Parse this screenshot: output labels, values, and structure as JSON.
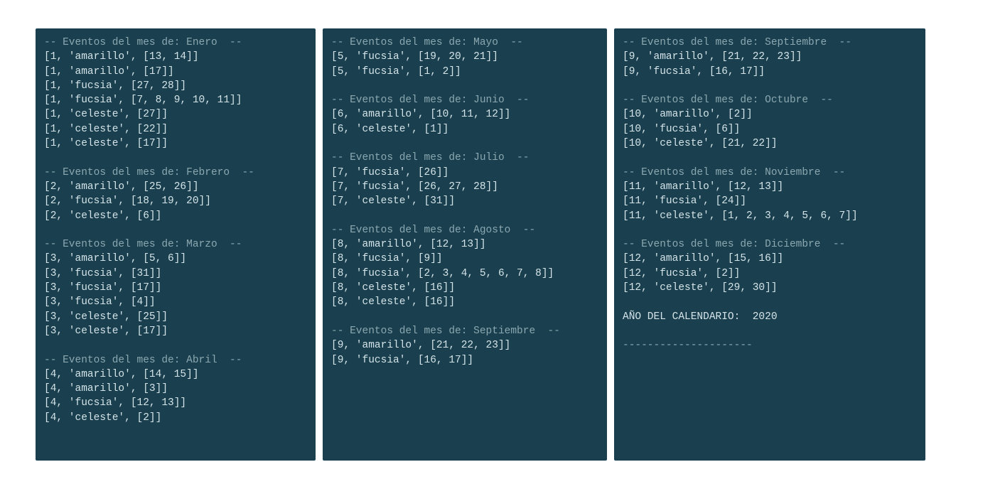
{
  "header_prefix": "-- Eventos del mes de: ",
  "header_suffix": "  --",
  "footer_label": "AÑO DEL CALENDARIO:  ",
  "footer_year": "2020",
  "footer_divider": "---------------------",
  "panels": [
    {
      "months": [
        {
          "name": "Enero",
          "events": [
            {
              "month": 1,
              "color": "amarillo",
              "days": [
                13,
                14
              ]
            },
            {
              "month": 1,
              "color": "amarillo",
              "days": [
                17
              ]
            },
            {
              "month": 1,
              "color": "fucsia",
              "days": [
                27,
                28
              ]
            },
            {
              "month": 1,
              "color": "fucsia",
              "days": [
                7,
                8,
                9,
                10,
                11
              ]
            },
            {
              "month": 1,
              "color": "celeste",
              "days": [
                27
              ]
            },
            {
              "month": 1,
              "color": "celeste",
              "days": [
                22
              ]
            },
            {
              "month": 1,
              "color": "celeste",
              "days": [
                17
              ]
            }
          ]
        },
        {
          "name": "Febrero",
          "events": [
            {
              "month": 2,
              "color": "amarillo",
              "days": [
                25,
                26
              ]
            },
            {
              "month": 2,
              "color": "fucsia",
              "days": [
                18,
                19,
                20
              ]
            },
            {
              "month": 2,
              "color": "celeste",
              "days": [
                6
              ]
            }
          ]
        },
        {
          "name": "Marzo",
          "events": [
            {
              "month": 3,
              "color": "amarillo",
              "days": [
                5,
                6
              ]
            },
            {
              "month": 3,
              "color": "fucsia",
              "days": [
                31
              ]
            },
            {
              "month": 3,
              "color": "fucsia",
              "days": [
                17
              ]
            },
            {
              "month": 3,
              "color": "fucsia",
              "days": [
                4
              ]
            },
            {
              "month": 3,
              "color": "celeste",
              "days": [
                25
              ]
            },
            {
              "month": 3,
              "color": "celeste",
              "days": [
                17
              ]
            }
          ]
        },
        {
          "name": "Abril",
          "events": [
            {
              "month": 4,
              "color": "amarillo",
              "days": [
                14,
                15
              ]
            },
            {
              "month": 4,
              "color": "amarillo",
              "days": [
                3
              ]
            },
            {
              "month": 4,
              "color": "fucsia",
              "days": [
                12,
                13
              ]
            },
            {
              "month": 4,
              "color": "celeste",
              "days": [
                2
              ]
            }
          ]
        }
      ]
    },
    {
      "months": [
        {
          "name": "Mayo",
          "events": [
            {
              "month": 5,
              "color": "fucsia",
              "days": [
                19,
                20,
                21
              ]
            },
            {
              "month": 5,
              "color": "fucsia",
              "days": [
                1,
                2
              ]
            }
          ]
        },
        {
          "name": "Junio",
          "events": [
            {
              "month": 6,
              "color": "amarillo",
              "days": [
                10,
                11,
                12
              ]
            },
            {
              "month": 6,
              "color": "celeste",
              "days": [
                1
              ]
            }
          ]
        },
        {
          "name": "Julio",
          "events": [
            {
              "month": 7,
              "color": "fucsia",
              "days": [
                26
              ]
            },
            {
              "month": 7,
              "color": "fucsia",
              "days": [
                26,
                27,
                28
              ]
            },
            {
              "month": 7,
              "color": "celeste",
              "days": [
                31
              ]
            }
          ]
        },
        {
          "name": "Agosto",
          "events": [
            {
              "month": 8,
              "color": "amarillo",
              "days": [
                12,
                13
              ]
            },
            {
              "month": 8,
              "color": "fucsia",
              "days": [
                9
              ]
            },
            {
              "month": 8,
              "color": "fucsia",
              "days": [
                2,
                3,
                4,
                5,
                6,
                7,
                8
              ]
            },
            {
              "month": 8,
              "color": "celeste",
              "days": [
                16
              ]
            },
            {
              "month": 8,
              "color": "celeste",
              "days": [
                16
              ]
            }
          ]
        },
        {
          "name": "Septiembre",
          "events": [
            {
              "month": 9,
              "color": "amarillo",
              "days": [
                21,
                22,
                23
              ]
            },
            {
              "month": 9,
              "color": "fucsia",
              "days": [
                16,
                17
              ]
            }
          ]
        }
      ]
    },
    {
      "months": [
        {
          "name": "Septiembre",
          "events": [
            {
              "month": 9,
              "color": "amarillo",
              "days": [
                21,
                22,
                23
              ]
            },
            {
              "month": 9,
              "color": "fucsia",
              "days": [
                16,
                17
              ]
            }
          ]
        },
        {
          "name": "Octubre",
          "events": [
            {
              "month": 10,
              "color": "amarillo",
              "days": [
                2
              ]
            },
            {
              "month": 10,
              "color": "fucsia",
              "days": [
                6
              ]
            },
            {
              "month": 10,
              "color": "celeste",
              "days": [
                21,
                22
              ]
            }
          ]
        },
        {
          "name": "Noviembre",
          "events": [
            {
              "month": 11,
              "color": "amarillo",
              "days": [
                12,
                13
              ]
            },
            {
              "month": 11,
              "color": "fucsia",
              "days": [
                24
              ]
            },
            {
              "month": 11,
              "color": "celeste",
              "days": [
                1,
                2,
                3,
                4,
                5,
                6,
                7
              ]
            }
          ]
        },
        {
          "name": "Diciembre",
          "events": [
            {
              "month": 12,
              "color": "amarillo",
              "days": [
                15,
                16
              ]
            },
            {
              "month": 12,
              "color": "fucsia",
              "days": [
                2
              ]
            },
            {
              "month": 12,
              "color": "celeste",
              "days": [
                29,
                30
              ]
            }
          ]
        }
      ],
      "has_footer": true
    }
  ]
}
